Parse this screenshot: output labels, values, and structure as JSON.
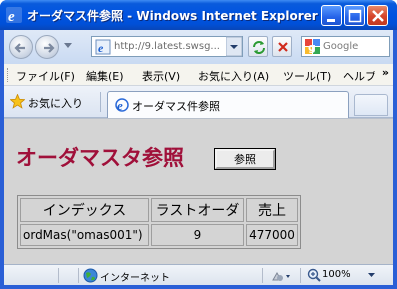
{
  "window": {
    "title": "オーダマス件参照 - Windows Internet Explorer"
  },
  "toolbar": {
    "address_url": "http://9.latest.swsg...",
    "search_placeholder": "Google"
  },
  "menu": {
    "items": [
      "ファイル(F)",
      "編集(E)",
      "表示(V)",
      "お気に入り(A)",
      "ツール(T)",
      "ヘルプ"
    ],
    "more": "»"
  },
  "tabs": {
    "favorites_label": "お気に入り",
    "active_tab_label": "オーダマス件参照"
  },
  "page": {
    "heading": "オーダマスタ参照",
    "ref_button_label": "参照",
    "table": {
      "headers": [
        "インデックス",
        "ラストオーダ",
        "売上"
      ],
      "rows": [
        [
          "ordMas(\"omas001\")",
          "9",
          "477000"
        ]
      ]
    }
  },
  "statusbar": {
    "zone": "インターネット",
    "zoom": "100%"
  },
  "colors": {
    "heading": "#a0103a",
    "titlebar": "#0053e1",
    "content_bg": "#d4d4d4"
  }
}
